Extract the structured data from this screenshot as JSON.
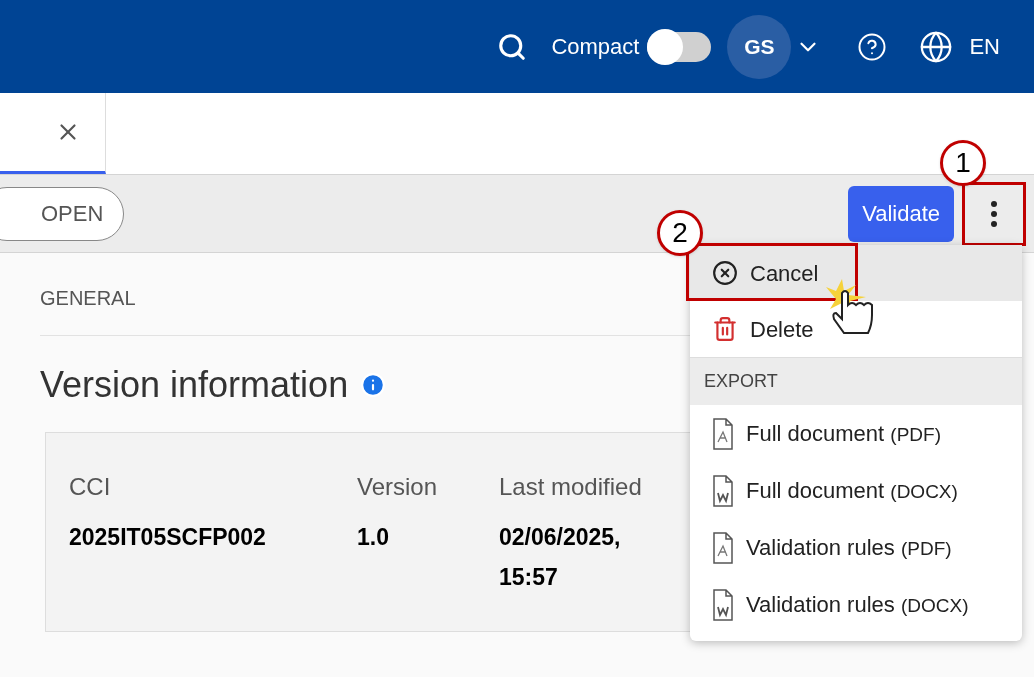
{
  "header": {
    "compact_label": "Compact",
    "compact_on": false,
    "avatar": "GS",
    "language": "EN"
  },
  "toolbar": {
    "status": "OPEN",
    "validate": "Validate"
  },
  "section": {
    "label": "GENERAL",
    "title": "Version information"
  },
  "info": [
    {
      "label": "CCI",
      "value": "2025IT05SCFP002"
    },
    {
      "label": "Version",
      "value": "1.0"
    },
    {
      "label": "Last modified",
      "value": "02/06/2025, 15:57"
    }
  ],
  "menu": {
    "items": [
      {
        "kind": "cancel",
        "label": "Cancel",
        "selected": true
      },
      {
        "kind": "delete",
        "label": "Delete",
        "selected": false
      }
    ],
    "export_heading": "EXPORT",
    "exports": [
      {
        "kind": "pdf",
        "label": "Full document",
        "format": "(PDF)"
      },
      {
        "kind": "docx",
        "label": "Full document",
        "format": "(DOCX)"
      },
      {
        "kind": "pdf",
        "label": "Validation rules",
        "format": "(PDF)"
      },
      {
        "kind": "docx",
        "label": "Validation rules",
        "format": "(DOCX)"
      }
    ]
  },
  "callouts": [
    "1",
    "2"
  ]
}
